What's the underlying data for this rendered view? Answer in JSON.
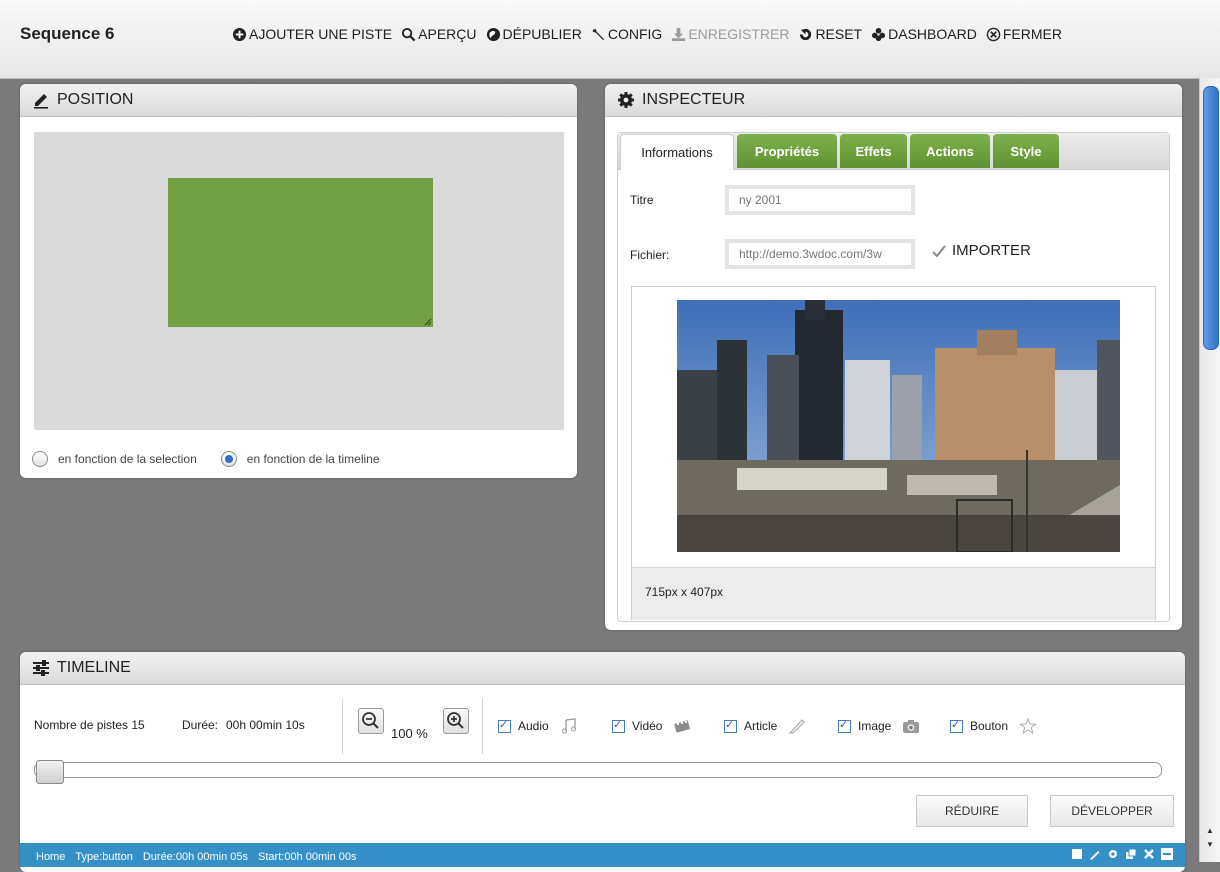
{
  "header": {
    "title": "Sequence 6",
    "buttons": [
      {
        "label": "AJOUTER UNE PISTE",
        "icon": "plus-circle-icon",
        "enabled": true
      },
      {
        "label": "APERÇU",
        "icon": "search-icon",
        "enabled": true
      },
      {
        "label": "DÉPUBLIER",
        "icon": "globe-icon",
        "enabled": true
      },
      {
        "label": "CONFIG",
        "icon": "wrench-icon",
        "enabled": true
      },
      {
        "label": "ENREGISTRER",
        "icon": "download-icon",
        "enabled": false
      },
      {
        "label": "RESET",
        "icon": "reset-icon",
        "enabled": true
      },
      {
        "label": "DASHBOARD",
        "icon": "dashboard-icon",
        "enabled": true
      },
      {
        "label": "FERMER",
        "icon": "close-circle-icon",
        "enabled": true
      }
    ]
  },
  "position_panel": {
    "title": "POSITION",
    "icon": "pencil-icon",
    "box_color": "#74a045",
    "radio_selection": "en fonction de la selection",
    "radio_timeline": "en fonction de la timeline",
    "selected_radio": "timeline"
  },
  "inspector": {
    "title": "INSPECTEUR",
    "icon": "gear-icon",
    "tabs": [
      "Informations",
      "Propriétés",
      "Effets",
      "Actions",
      "Style"
    ],
    "active_tab": "Informations",
    "titre_label": "Titre",
    "titre_value": "ny 2001",
    "fichier_label": "Fichier:",
    "fichier_value": "http://demo.3wdoc.com/3w",
    "importer_label": "IMPORTER",
    "image_dimensions": "715px x 407px"
  },
  "timeline": {
    "title": "TIMELINE",
    "icon": "sliders-icon",
    "tracks_label": "Nombre de pistes 15",
    "duration_label": "Durée:",
    "duration_value": "00h 00min 10s",
    "zoom": "100 %",
    "filters": [
      {
        "label": "Audio",
        "icon": "music-note-icon",
        "checked": true
      },
      {
        "label": "Vidéo",
        "icon": "film-icon",
        "checked": true
      },
      {
        "label": "Article",
        "icon": "pencil-icon",
        "checked": true
      },
      {
        "label": "Image",
        "icon": "camera-icon",
        "checked": true
      },
      {
        "label": "Bouton",
        "icon": "star-icon",
        "checked": true
      }
    ],
    "reduce_label": "RÉDUIRE",
    "develop_label": "DÉVELOPPER",
    "status": {
      "home": "Home",
      "type": "Type:button",
      "duree": "Durée:00h 00min 05s",
      "start": "Start:00h 00min 00s"
    }
  }
}
